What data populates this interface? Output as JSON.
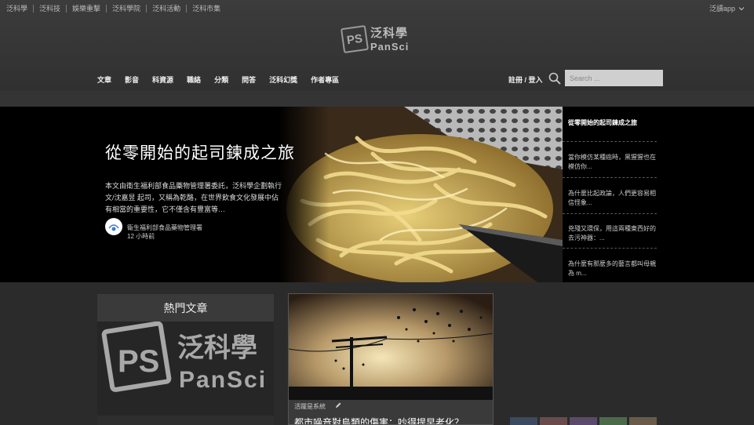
{
  "topbar": {
    "links": [
      "泛科學",
      "泛科技",
      "娛樂重擊",
      "泛科學院",
      "泛科活動",
      "泛科市集"
    ],
    "app_label": "泛讀app"
  },
  "logo": {
    "chinese": "泛科學",
    "english": "PanSci",
    "mark": "PS"
  },
  "nav": {
    "items": [
      "文章",
      "影音",
      "科資源",
      "職絡",
      "分類",
      "問答",
      "泛科幻獎",
      "作者專區"
    ],
    "auth": "註冊 / 登入",
    "search_placeholder": "Search ..."
  },
  "hero": {
    "title": "從零開始的起司鍊成之旅",
    "summary": "本文由衛生福利部食品藥物管理署委託，泛科學企劃執行 文/沈嘉昱 起司，又稱為乾酪，在世界飲食文化發展中佔有相當的重要性，它不僅含有豐富等…",
    "author": "衛生福利部食品藥物管理署",
    "time": "12 小時前"
  },
  "sidebar": {
    "items": [
      "從零開始的起司鍊成之旅",
      "當你模仿某種癌時，黑猩猩也在模仿你...",
      "為什麼比起政論，人們更容易相信怪象...",
      "兇殘又環保，用這兩種東西好的去污神器：...",
      "為什麼有那麼多的藝言都叫母親為 m..."
    ]
  },
  "popular": {
    "heading": "熱門文章",
    "logo_cn": "泛科學",
    "logo_en": "PanSci",
    "logo_mark": "PS"
  },
  "card": {
    "category": "活躍是系統",
    "title": "都市噪音對鳥類的傷害：吵得提早老化？"
  },
  "colors": {
    "header_bg": "#3a3a3a",
    "page_bg": "#2b2b2b",
    "hero_bg": "#000000",
    "search_bg": "#cfcfcf"
  }
}
